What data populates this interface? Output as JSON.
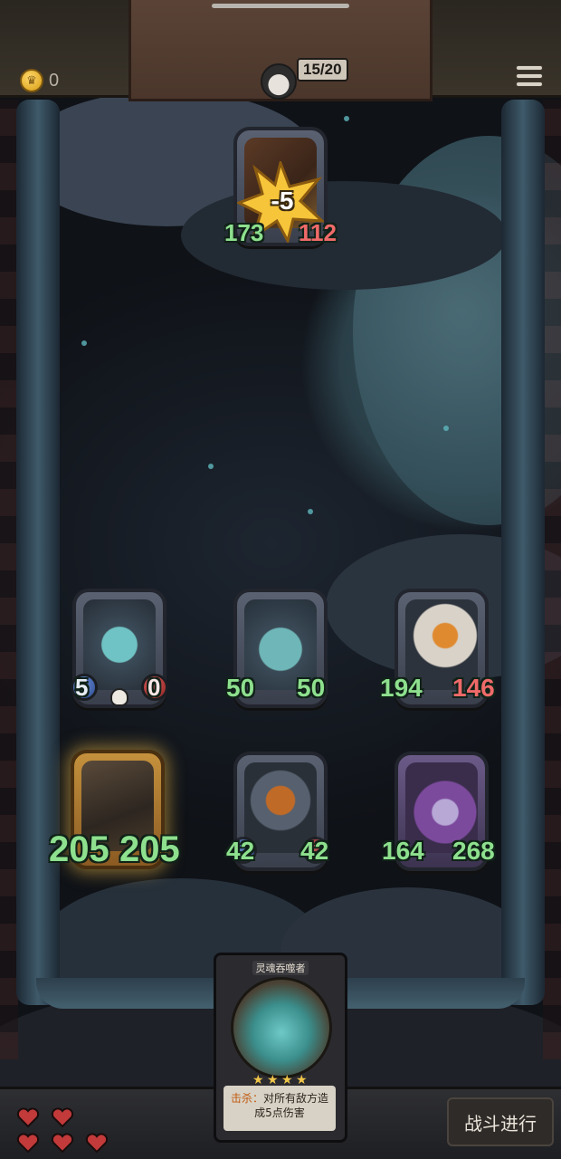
{
  "topbar": {
    "coins": "0",
    "hero_counter": "15/20"
  },
  "enemy": {
    "damage_popup": "-5",
    "attack": "173",
    "health": "112"
  },
  "board": {
    "row1": [
      {
        "name": "ghost",
        "attack": "5",
        "health": "0"
      },
      {
        "name": "spirit-beast",
        "attack": "50",
        "health": "50"
      },
      {
        "name": "pumpkin-mummy",
        "attack": "194",
        "health": "146"
      }
    ],
    "row2": [
      {
        "name": "barbarian",
        "attack": "205",
        "health": "205"
      },
      {
        "name": "pumpkin-knight",
        "attack": "42",
        "health": "42"
      },
      {
        "name": "witch",
        "attack": "164",
        "health": "268"
      }
    ]
  },
  "hand_card": {
    "title": "灵魂吞噬者",
    "stars": 4,
    "keyword": "击杀：",
    "description": "对所有敌方造成5点伤害"
  },
  "lives": {
    "count": 5
  },
  "battle_button": "战斗进行",
  "colors": {
    "attack": "#8ee08e",
    "health": "#f06a6a",
    "gold_frame": "#c5913d"
  }
}
